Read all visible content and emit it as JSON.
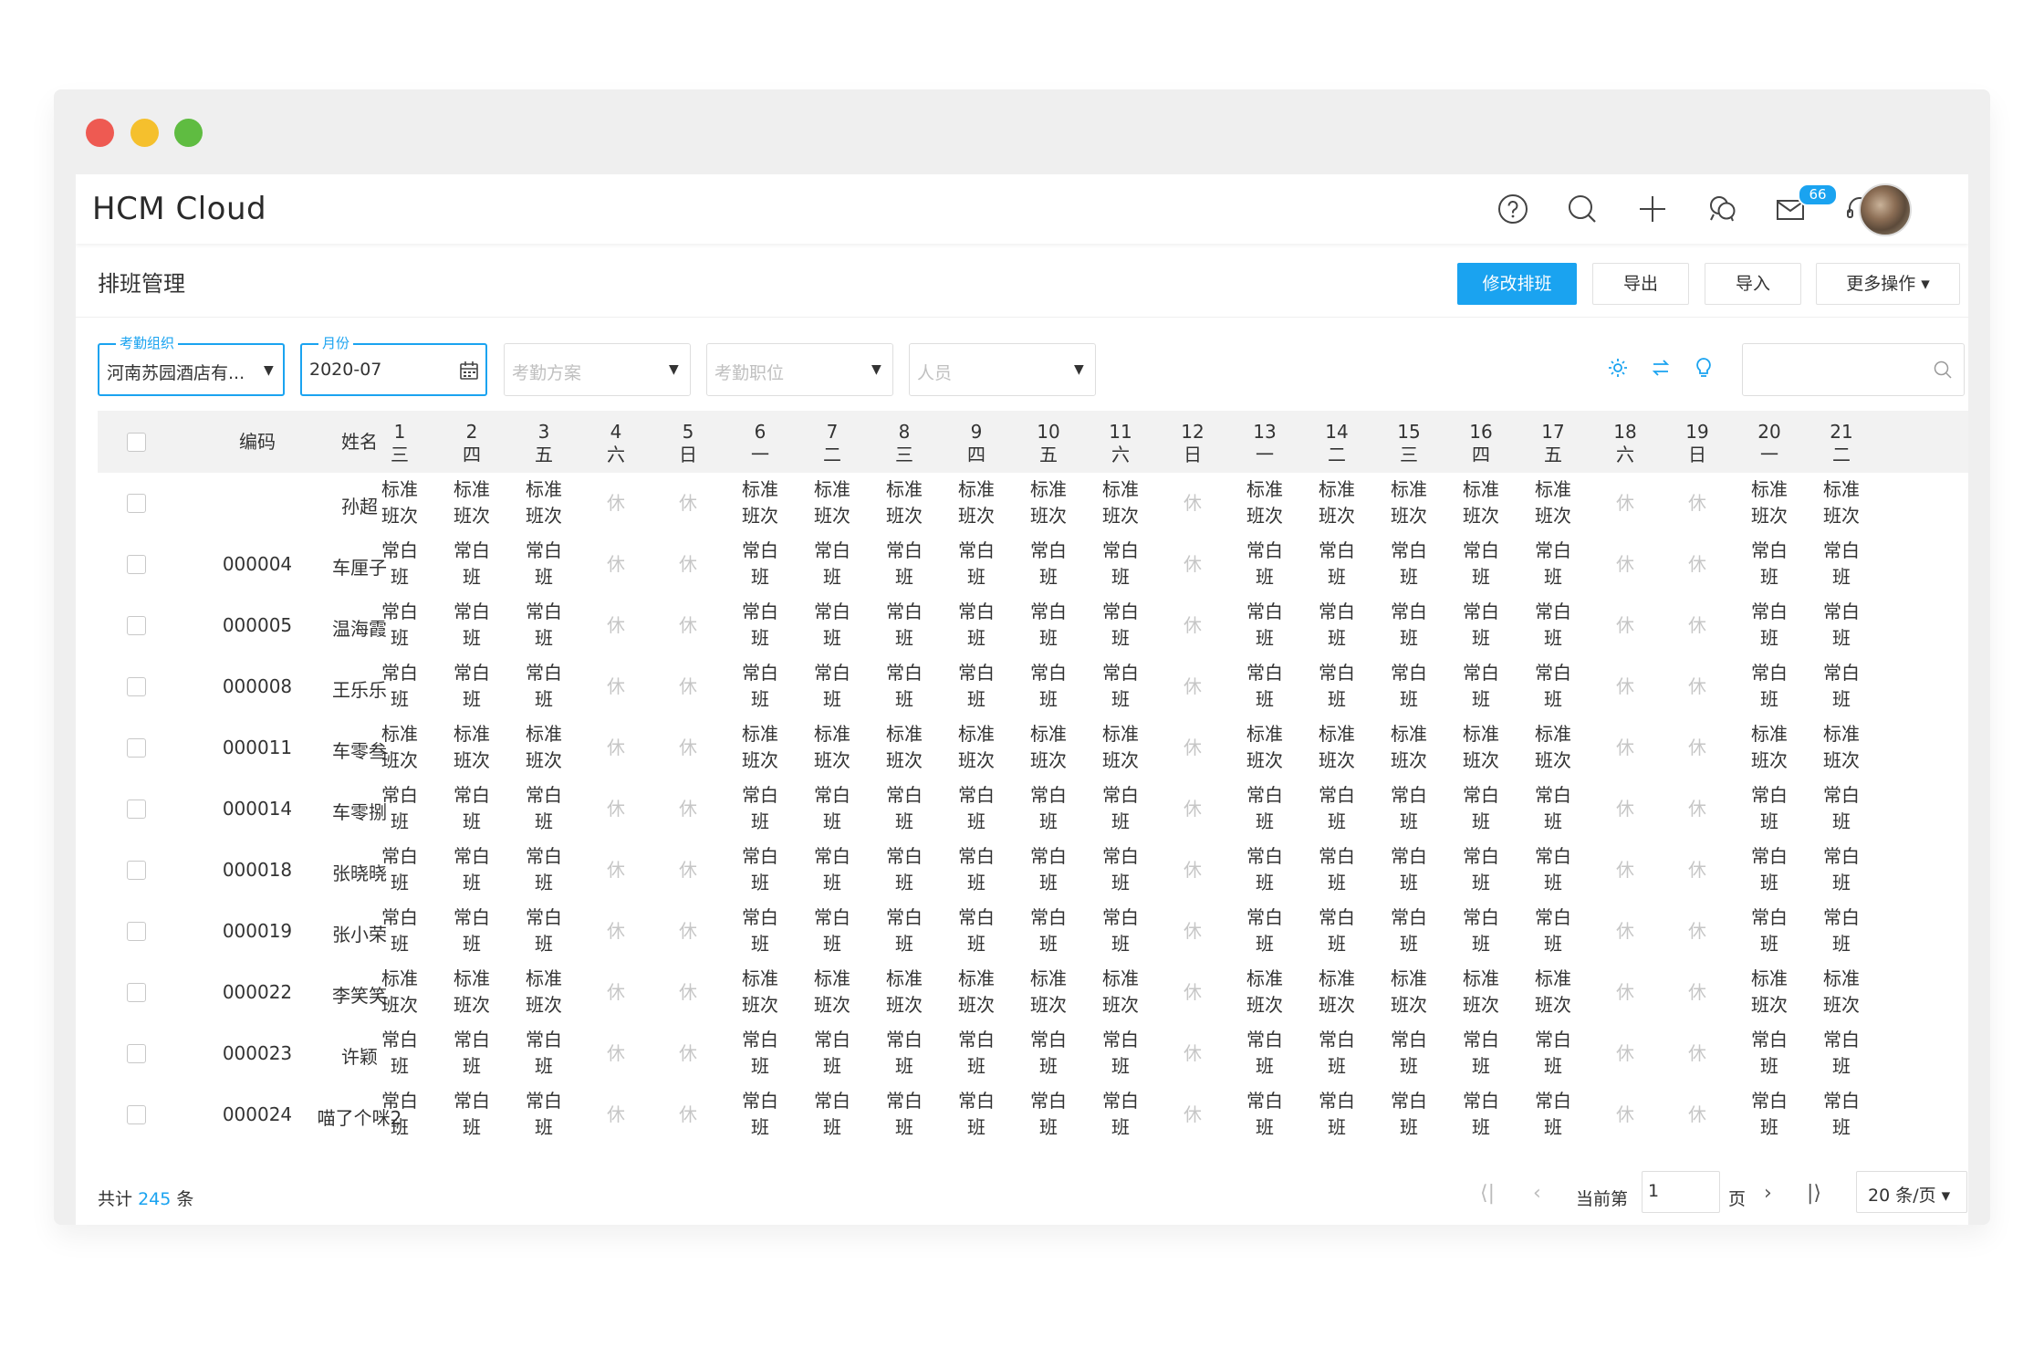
{
  "app": {
    "title": "HCM Cloud",
    "mail_badge": "66"
  },
  "page": {
    "title": "排班管理",
    "buttons": {
      "edit": "修改排班",
      "export": "导出",
      "import": "导入",
      "more": "更多操作 ▾"
    }
  },
  "filters": {
    "org": {
      "label": "考勤组织",
      "value": "河南苏园酒店有..."
    },
    "month": {
      "label": "月份",
      "value": "2020-07"
    },
    "plan": {
      "placeholder": "考勤方案"
    },
    "position": {
      "placeholder": "考勤职位"
    },
    "person": {
      "placeholder": "人员"
    },
    "search": {
      "placeholder": ""
    }
  },
  "table": {
    "col_code": "编码",
    "col_name": "姓名",
    "days": [
      {
        "d": "1",
        "w": "三"
      },
      {
        "d": "2",
        "w": "四"
      },
      {
        "d": "3",
        "w": "五"
      },
      {
        "d": "4",
        "w": "六"
      },
      {
        "d": "5",
        "w": "日"
      },
      {
        "d": "6",
        "w": "一"
      },
      {
        "d": "7",
        "w": "二"
      },
      {
        "d": "8",
        "w": "三"
      },
      {
        "d": "9",
        "w": "四"
      },
      {
        "d": "10",
        "w": "五"
      },
      {
        "d": "11",
        "w": "六"
      },
      {
        "d": "12",
        "w": "日"
      },
      {
        "d": "13",
        "w": "一"
      },
      {
        "d": "14",
        "w": "二"
      },
      {
        "d": "15",
        "w": "三"
      },
      {
        "d": "16",
        "w": "四"
      },
      {
        "d": "17",
        "w": "五"
      },
      {
        "d": "18",
        "w": "六"
      },
      {
        "d": "19",
        "w": "日"
      },
      {
        "d": "20",
        "w": "一"
      },
      {
        "d": "21",
        "w": "二"
      }
    ],
    "shifts": {
      "std": [
        "标准",
        "班次"
      ],
      "day": [
        "常白",
        "班"
      ],
      "rest": [
        "休"
      ]
    },
    "day_types": [
      "w",
      "w",
      "w",
      "r",
      "r",
      "w",
      "w",
      "w",
      "w",
      "w",
      "w",
      "r",
      "w",
      "w",
      "w",
      "w",
      "w",
      "r",
      "r",
      "w",
      "w"
    ],
    "rows": [
      {
        "code": "",
        "name": "孙超",
        "shift": "std"
      },
      {
        "code": "000004",
        "name": "车厘子",
        "shift": "day"
      },
      {
        "code": "000005",
        "name": "温海霞",
        "shift": "day"
      },
      {
        "code": "000008",
        "name": "王乐乐",
        "shift": "day"
      },
      {
        "code": "000011",
        "name": "车零叁",
        "shift": "std"
      },
      {
        "code": "000014",
        "name": "车零捌",
        "shift": "day"
      },
      {
        "code": "000018",
        "name": "张晓晓",
        "shift": "day"
      },
      {
        "code": "000019",
        "name": "张小荣",
        "shift": "day"
      },
      {
        "code": "000022",
        "name": "李笑笑",
        "shift": "std"
      },
      {
        "code": "000023",
        "name": "许颖",
        "shift": "day"
      },
      {
        "code": "000024",
        "name": "喵了个咪2",
        "shift": "day"
      }
    ]
  },
  "footer": {
    "total_prefix": "共计",
    "total": "245",
    "total_suffix": "条",
    "current_label": "当前第",
    "current_page": "1",
    "page_suffix": "页",
    "page_size": "20 条/页 ▾"
  },
  "colors": {
    "accent": "#1aa3f0"
  }
}
